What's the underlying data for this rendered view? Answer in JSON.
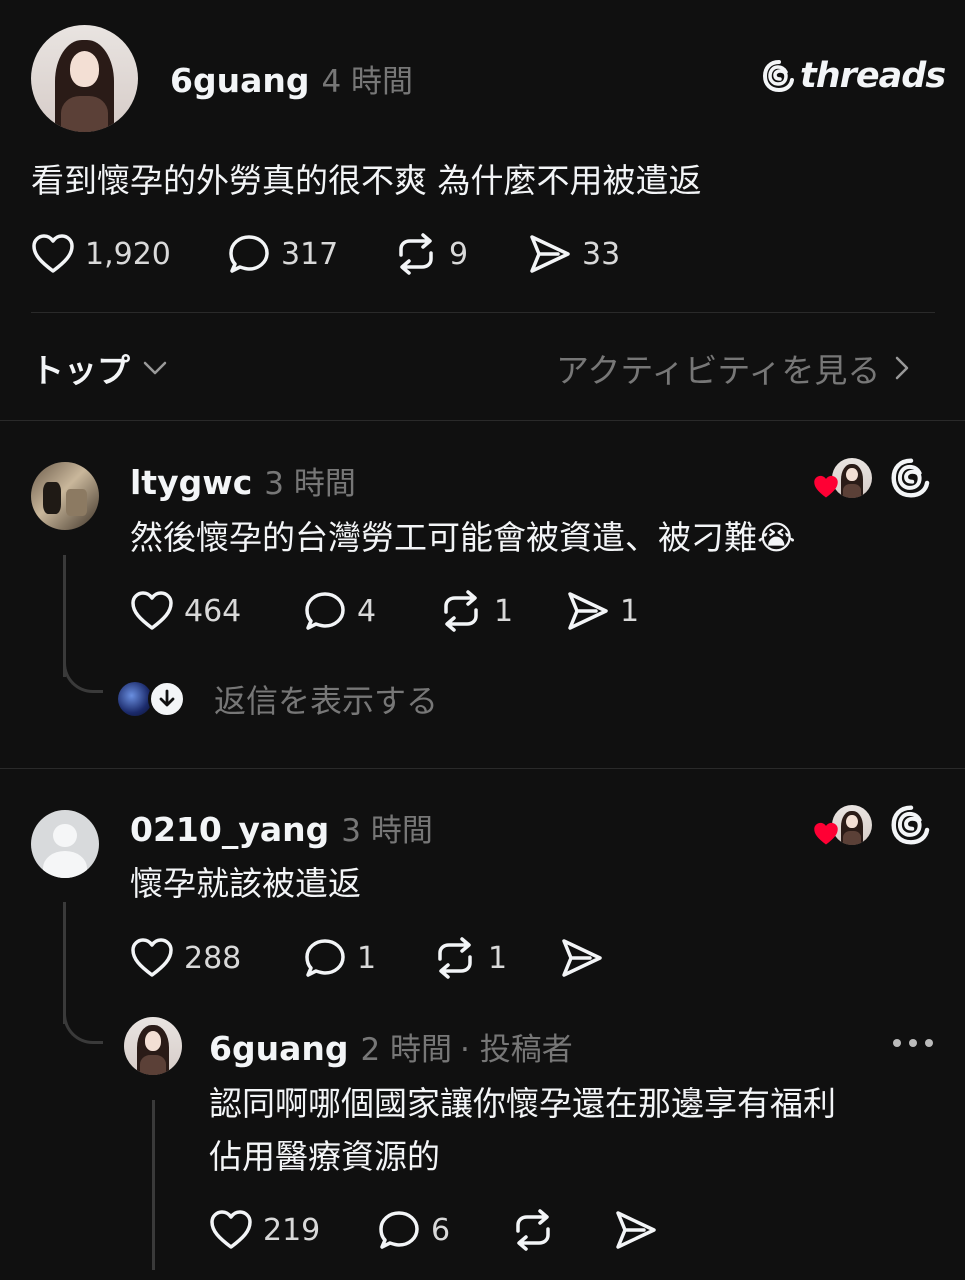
{
  "post": {
    "username": "6guang",
    "time": "4 時間",
    "brand": "threads",
    "text": "看到懷孕的外勞真的很不爽 為什麼不用被遣返",
    "likes": "1,920",
    "comments": "317",
    "reposts": "9",
    "shares": "33"
  },
  "filter": {
    "sort_label": "トップ",
    "activity_label": "アクティビティを見る"
  },
  "replies": [
    {
      "username": "ltygwc",
      "time": "3 時間",
      "text": "然後懷孕的台灣勞工可能會被資遣、被刁難😭",
      "likes": "464",
      "comments": "4",
      "reposts": "1",
      "shares": "1",
      "show_replies": "返信を表示する"
    },
    {
      "username": "0210_yang",
      "time": "3 時間",
      "text": "懷孕就該被遣返",
      "likes": "288",
      "comments": "1",
      "reposts": "1",
      "shares": ""
    }
  ],
  "nested_reply": {
    "username": "6guang",
    "time": "2 時間",
    "author_tag": "· 投稿者",
    "text_line1": "認同啊哪個國家讓你懷孕還在那邊享有福利",
    "text_line2": "佔用醫療資源的",
    "likes": "219",
    "comments": "6",
    "reposts": "",
    "shares": ""
  },
  "colors": {
    "background": "#101010",
    "text": "#f3f5f7",
    "muted": "#777777",
    "heart": "#ff0034"
  },
  "icons": [
    "heart-icon",
    "comment-icon",
    "repost-icon",
    "share-icon",
    "chevron-down-icon",
    "chevron-right-icon",
    "threads-logo-icon",
    "more-icon",
    "down-arrow-icon"
  ]
}
